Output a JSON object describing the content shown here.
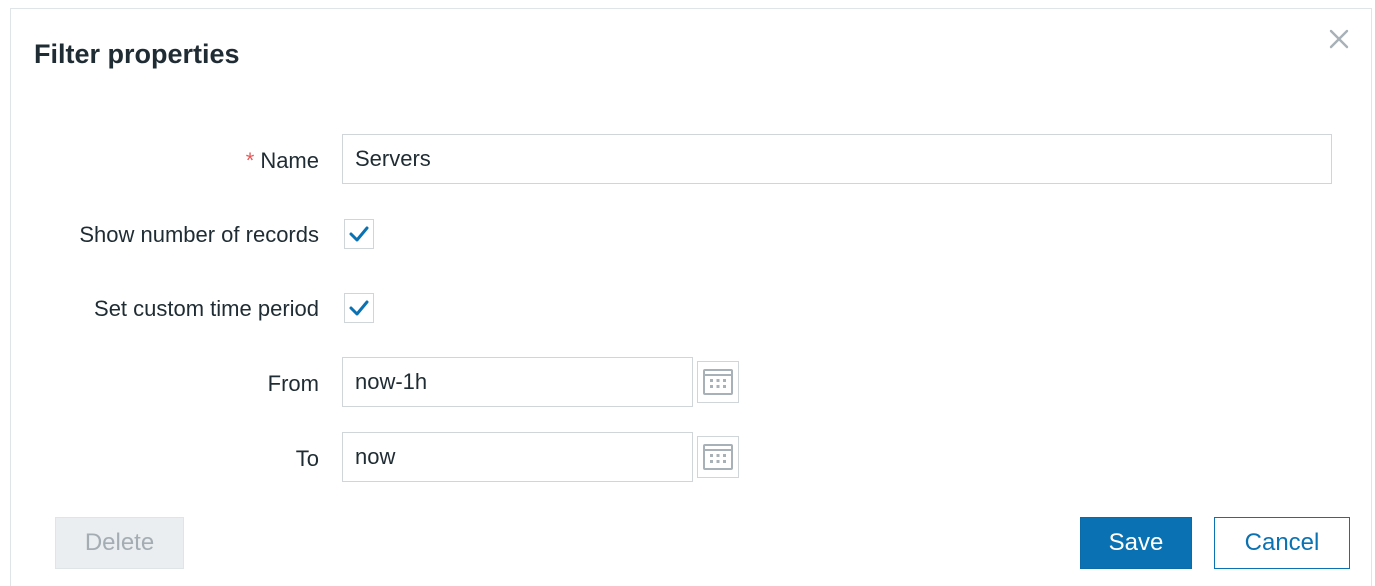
{
  "dialog": {
    "title": "Filter properties",
    "close_icon": "close-icon"
  },
  "form": {
    "name": {
      "required_marker": "*",
      "label": "Name",
      "value": "Servers"
    },
    "show_number_of_records": {
      "label": "Show number of records",
      "checked": true
    },
    "set_custom_time_period": {
      "label": "Set custom time period",
      "checked": true
    },
    "from": {
      "label": "From",
      "value": "now-1h",
      "calendar_icon": "calendar-icon"
    },
    "to": {
      "label": "To",
      "value": "now",
      "calendar_icon": "calendar-icon"
    }
  },
  "buttons": {
    "delete": "Delete",
    "save": "Save",
    "cancel": "Cancel"
  },
  "colors": {
    "primary": "#0a72b3",
    "required": "#e45959",
    "text": "#1f2c33",
    "disabled_text": "#a3adb3",
    "border": "#cfd5d9"
  }
}
